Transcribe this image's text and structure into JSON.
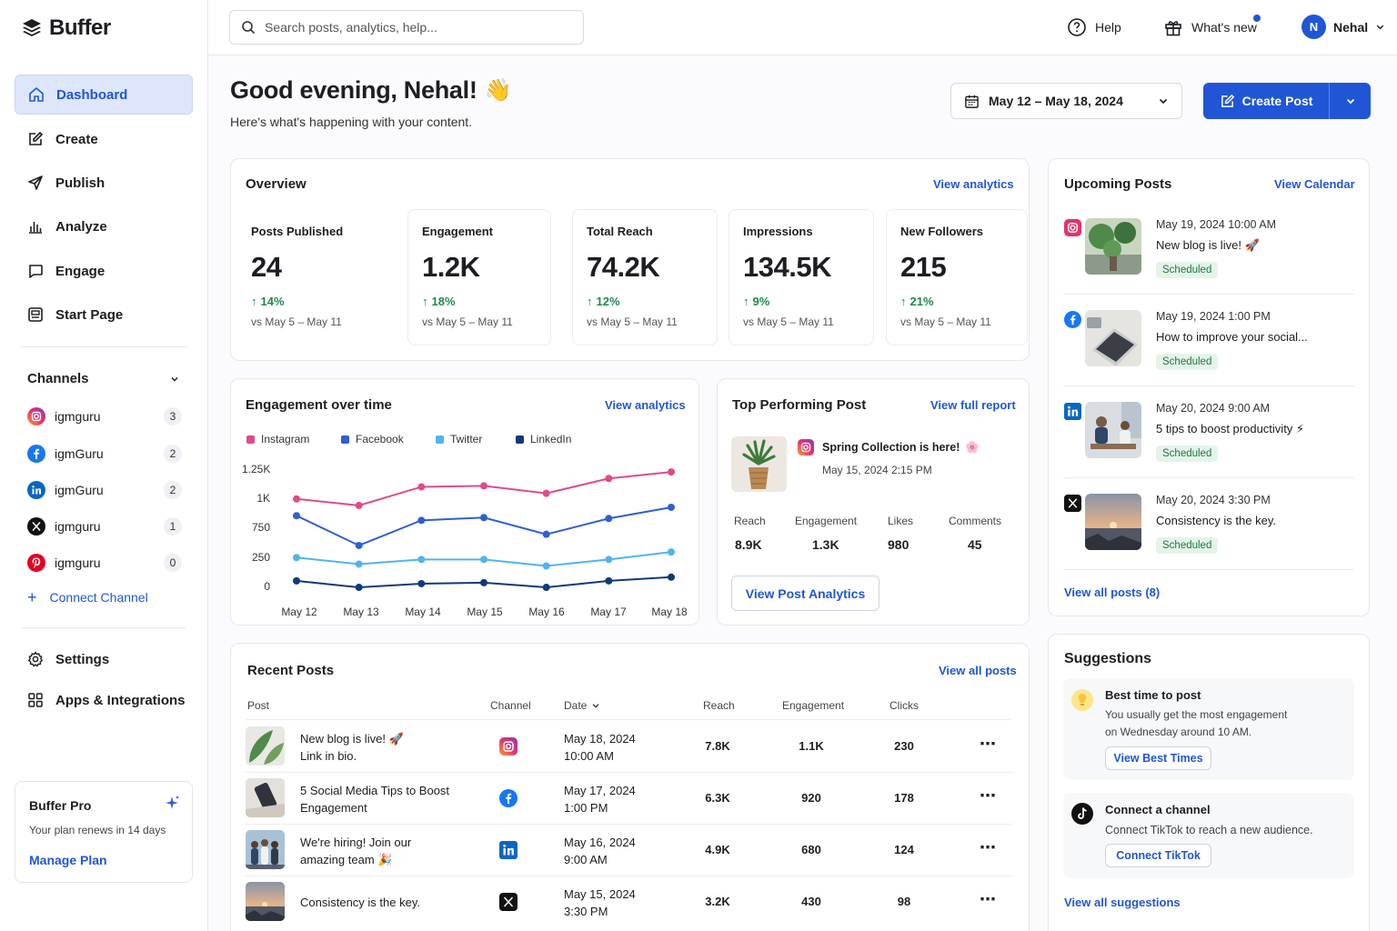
{
  "app": {
    "name": "Buffer"
  },
  "sidebar": {
    "nav": [
      {
        "label": "Dashboard",
        "icon": "home-icon",
        "active": true
      },
      {
        "label": "Create",
        "icon": "edit-icon"
      },
      {
        "label": "Publish",
        "icon": "send-icon"
      },
      {
        "label": "Analyze",
        "icon": "bar-chart-icon"
      },
      {
        "label": "Engage",
        "icon": "chat-icon"
      },
      {
        "label": "Start Page",
        "icon": "page-icon"
      }
    ],
    "channels_title": "Channels",
    "channels": [
      {
        "name": "igmguru",
        "network": "instagram",
        "count": "3"
      },
      {
        "name": "igmGuru",
        "network": "facebook",
        "count": "2"
      },
      {
        "name": "igmGuru",
        "network": "linkedin",
        "count": "2"
      },
      {
        "name": "igmguru",
        "network": "twitter",
        "count": "1"
      },
      {
        "name": "igmguru",
        "network": "pinterest",
        "count": "0"
      }
    ],
    "connect_channel": "Connect Channel",
    "bottom_nav": [
      {
        "label": "Settings",
        "icon": "gear-icon"
      },
      {
        "label": "Apps & Integrations",
        "icon": "grid-icon"
      }
    ],
    "plan": {
      "title": "Buffer Pro",
      "renew": "Your plan renews in 14 days",
      "manage": "Manage Plan"
    }
  },
  "topbar": {
    "search_placeholder": "Search posts, analytics, help...",
    "help": "Help",
    "whats_new": "What's new",
    "user_initial": "N",
    "user_name": "Nehal"
  },
  "header": {
    "greeting": "Good evening, Nehal!",
    "emoji": "👋",
    "subtitle": "Here's what's happening with your content.",
    "date_range": "May 12 – May 18, 2024",
    "create_post": "Create Post"
  },
  "overview": {
    "title": "Overview",
    "link": "View analytics",
    "metrics": [
      {
        "label": "Posts Published",
        "value": "24",
        "change": "14%",
        "vs": "vs May 5 – May 11"
      },
      {
        "label": "Engagement",
        "value": "1.2K",
        "change": "18%",
        "vs": "vs May 5 – May 11"
      },
      {
        "label": "Total Reach",
        "value": "74.2K",
        "change": "12%",
        "vs": "vs May 5 – May 11"
      },
      {
        "label": "Impressions",
        "value": "134.5K",
        "change": "9%",
        "vs": "vs May 5 – May 11"
      },
      {
        "label": "New Followers",
        "value": "215",
        "change": "21%",
        "vs": "vs May 5 – May 11"
      }
    ]
  },
  "engagement": {
    "title": "Engagement over time",
    "link": "View analytics",
    "yticks": [
      "1.25K",
      "1K",
      "750",
      "250",
      "0"
    ],
    "legend": [
      {
        "name": "Instagram",
        "color": "#de4b8a"
      },
      {
        "name": "Facebook",
        "color": "#2f5fd0"
      },
      {
        "name": "Twitter",
        "color": "#52b3ee"
      },
      {
        "name": "LinkedIn",
        "color": "#0f3a7a"
      }
    ]
  },
  "chart_data": {
    "type": "line",
    "categories": [
      "May 12",
      "May 13",
      "May 14",
      "May 15",
      "May 16",
      "May 17",
      "May 18"
    ],
    "series": [
      {
        "name": "Instagram",
        "values": [
          930,
          860,
          1060,
          1070,
          990,
          1150,
          1220
        ]
      },
      {
        "name": "Facebook",
        "values": [
          750,
          430,
          700,
          730,
          550,
          720,
          840
        ]
      },
      {
        "name": "Twitter",
        "values": [
          300,
          230,
          280,
          280,
          210,
          280,
          360
        ]
      },
      {
        "name": "LinkedIn",
        "values": [
          50,
          -20,
          20,
          30,
          -20,
          50,
          90
        ]
      }
    ],
    "ytick_values": [
      1250,
      1000,
      750,
      250,
      0
    ],
    "ylim": [
      0,
      1250
    ]
  },
  "top_post": {
    "title": "Top Performing Post",
    "link": "View full report",
    "post_title": "Spring Collection is here!",
    "post_emoji": "🌸",
    "date": "May 15, 2024  2:15 PM",
    "stats": [
      {
        "label": "Reach",
        "value": "8.9K"
      },
      {
        "label": "Engagement",
        "value": "1.3K"
      },
      {
        "label": "Likes",
        "value": "980"
      },
      {
        "label": "Comments",
        "value": "45"
      }
    ],
    "button": "View Post Analytics"
  },
  "upcoming": {
    "title": "Upcoming Posts",
    "link": "View Calendar",
    "items": [
      {
        "network": "instagram",
        "date": "May 19, 2024  10:00 AM",
        "text": "New blog is live! 🚀",
        "status": "Scheduled"
      },
      {
        "network": "facebook",
        "date": "May 19, 2024  1:00 PM",
        "text": "How to improve your social...",
        "status": "Scheduled"
      },
      {
        "network": "linkedin",
        "date": "May 20, 2024  9:00 AM",
        "text": "5 tips to boost productivity ⚡",
        "status": "Scheduled"
      },
      {
        "network": "twitter",
        "date": "May 20, 2024  3:30 PM",
        "text": "Consistency is the key.",
        "status": "Scheduled"
      }
    ],
    "view_all": "View all posts (8)"
  },
  "recent": {
    "title": "Recent Posts",
    "link": "View all posts",
    "columns": {
      "post": "Post",
      "channel": "Channel",
      "date": "Date",
      "reach": "Reach",
      "engagement": "Engagement",
      "clicks": "Clicks"
    },
    "rows": [
      {
        "title": "New blog is live! 🚀",
        "sub": "Link in bio.",
        "network": "instagram",
        "date": "May 18, 2024",
        "time": "10:00 AM",
        "reach": "7.8K",
        "engagement": "1.1K",
        "clicks": "230"
      },
      {
        "title": "5 Social Media Tips to Boost",
        "sub": "Engagement",
        "network": "facebook",
        "date": "May 17, 2024",
        "time": "1:00 PM",
        "reach": "6.3K",
        "engagement": "920",
        "clicks": "178"
      },
      {
        "title": "We're hiring! Join our",
        "sub": "amazing team 🎉",
        "network": "linkedin",
        "date": "May 16, 2024",
        "time": "9:00 AM",
        "reach": "4.9K",
        "engagement": "680",
        "clicks": "124"
      },
      {
        "title": "Consistency is the key.",
        "sub": "",
        "network": "twitter",
        "date": "May 15, 2024",
        "time": "3:30 PM",
        "reach": "3.2K",
        "engagement": "430",
        "clicks": "98"
      }
    ]
  },
  "suggestions": {
    "title": "Suggestions",
    "items": [
      {
        "title": "Best time to post",
        "text1": "You usually get the most engagement",
        "text2": "on Wednesday around 10 AM.",
        "button": "View Best Times"
      },
      {
        "title": "Connect a channel",
        "text1": "Connect TikTok to reach a new audience.",
        "text2": "",
        "button": "Connect TikTok"
      }
    ],
    "view_all": "View all suggestions"
  },
  "colors": {
    "accent": "#2056d6",
    "positive": "#1f8a4c",
    "scheduled_bg": "#e5f4ea"
  }
}
